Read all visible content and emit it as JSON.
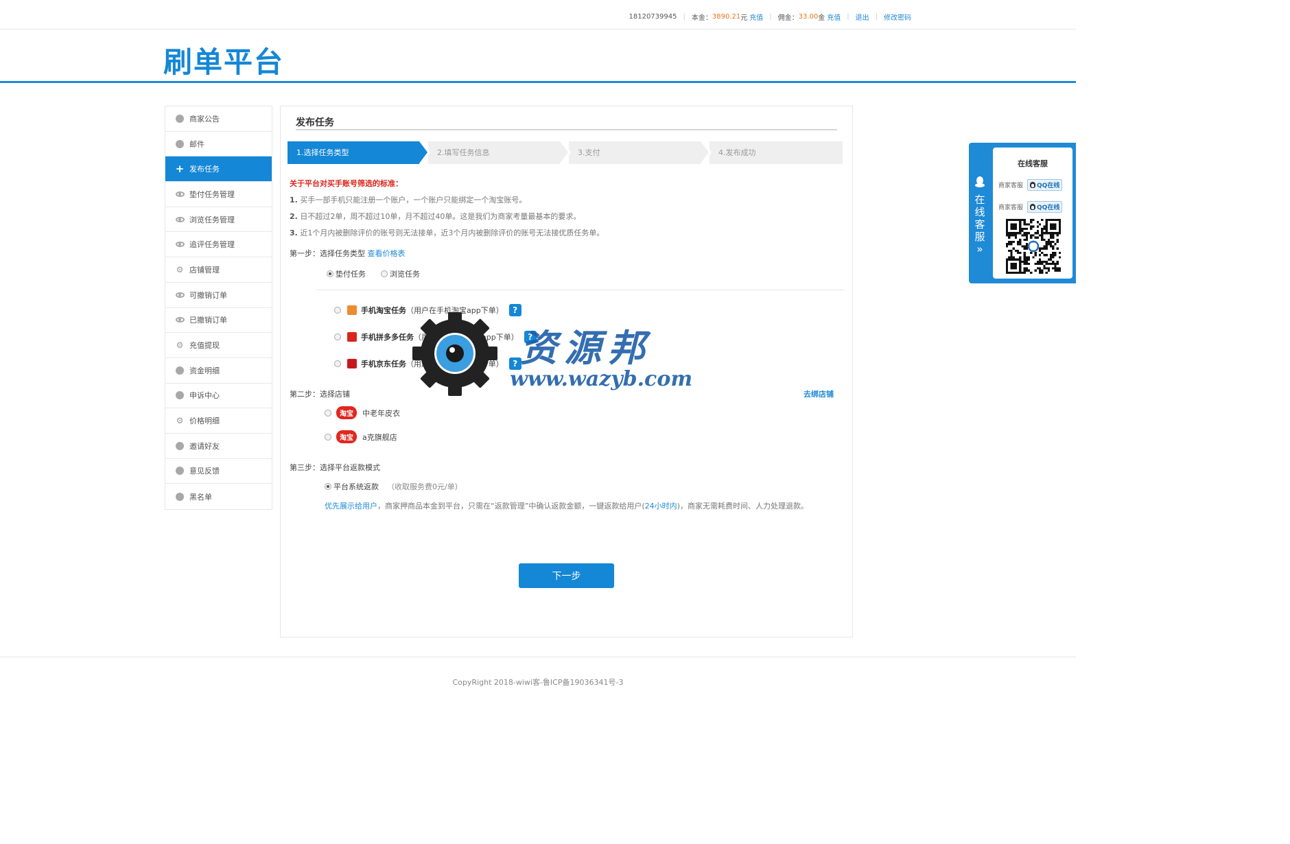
{
  "topbar": {
    "phone": "18120739945",
    "principal_label": "本金：",
    "principal_value": "3890.21",
    "principal_unit": "元",
    "recharge1": "充值",
    "commission_label": "佣金：",
    "commission_value": "33.00",
    "commission_unit": "金",
    "recharge2": "充值",
    "logout": "退出",
    "change_password": "修改密码"
  },
  "logo": "刷单平台",
  "sidebar": {
    "items": [
      {
        "label": "商家公告",
        "icon": "smiley-icon"
      },
      {
        "label": "邮件",
        "icon": "mail-icon"
      },
      {
        "label": "发布任务",
        "icon": "plus-icon",
        "active": true
      },
      {
        "label": "垫付任务管理",
        "icon": "eye-icon"
      },
      {
        "label": "浏览任务管理",
        "icon": "eye-icon"
      },
      {
        "label": "追评任务管理",
        "icon": "eye-icon"
      },
      {
        "label": "店铺管理",
        "icon": "gear-icon"
      },
      {
        "label": "可撤销订单",
        "icon": "eye-icon"
      },
      {
        "label": "已撤销订单",
        "icon": "eye-icon"
      },
      {
        "label": "充值提现",
        "icon": "gear-icon"
      },
      {
        "label": "资金明细",
        "icon": "database-icon"
      },
      {
        "label": "申诉中心",
        "icon": "chat-icon"
      },
      {
        "label": "价格明细",
        "icon": "gear-icon"
      },
      {
        "label": "邀请好友",
        "icon": "megaphone-icon"
      },
      {
        "label": "意见反馈",
        "icon": "feedback-icon"
      },
      {
        "label": "黑名单",
        "icon": "blacklist-icon"
      }
    ]
  },
  "main": {
    "title": "发布任务",
    "steps": [
      "1.选择任务类型",
      "2.填写任务信息",
      "3.支付",
      "4.发布成功"
    ],
    "rules_title": "关于平台对买手账号筛选的标准：",
    "rules": [
      {
        "num": "1.",
        "text": "买手一部手机只能注册一个账户，一个账户只能绑定一个淘宝账号。"
      },
      {
        "num": "2.",
        "text": "日不超过2单，周不超过10单，月不超过40单。这是我们为商家考量最基本的要求。"
      },
      {
        "num": "3.",
        "text": "近1个月内被删除评价的账号则无法接单，近3个月内被删除评价的账号无法接优质任务单。"
      }
    ],
    "step1_label": "第一步：选择任务类型",
    "price_table_link": "查看价格表",
    "task_types": [
      {
        "label": "垫付任务",
        "checked": true
      },
      {
        "label": "浏览任务",
        "checked": false
      }
    ],
    "platforms": [
      {
        "name": "手机淘宝任务",
        "note": "（用户在手机淘宝app下单）",
        "icon": "taobao-app-icon",
        "color": "#f08a2e"
      },
      {
        "name": "手机拼多多任务",
        "note": "（用户在手机拼多多app下单）",
        "icon": "pinduoduo-app-icon",
        "color": "#d9261c"
      },
      {
        "name": "手机京东任务",
        "note": "（用户在手机京东app下单）",
        "icon": "jd-app-icon",
        "color": "#c8161d"
      }
    ],
    "help_glyph": "?",
    "step2_label": "第二步：选择店铺",
    "bind_store_link": "去绑店铺",
    "taobao_badge": "淘宝",
    "stores": [
      "中老年皮衣",
      "a克旗舰店"
    ],
    "step3_label": "第三步：选择平台返款模式",
    "refund_mode": "平台系统返款",
    "refund_fee": "（收取服务费0元/单）",
    "refund_desc_link1": "优先展示给用户",
    "refund_desc_mid": "，商家押商品本金到平台，只需在“返款管理”中确认返款金额，一键返款给用户(",
    "refund_desc_link2": "24小时内",
    "refund_desc_end": ")，商家无需耗费时间、人力处理退款。",
    "next_button": "下一步"
  },
  "float_service": {
    "tab_chars": [
      "在",
      "线",
      "客",
      "服"
    ],
    "tab_arrow": "»",
    "title": "在线客服",
    "rows": [
      {
        "label": "商家客服",
        "badge": "QQ在线"
      },
      {
        "label": "商家客服",
        "badge": "QQ在线"
      }
    ]
  },
  "watermark": {
    "cn": "资源邦",
    "url": "www.wazyb.com"
  },
  "footer": "CopyRight 2018-wiwi客-鲁ICP备19036341号-3",
  "colors": {
    "brand_blue": "#1487d6",
    "warning_red": "#d9261c",
    "amount_orange": "#e5741b"
  }
}
